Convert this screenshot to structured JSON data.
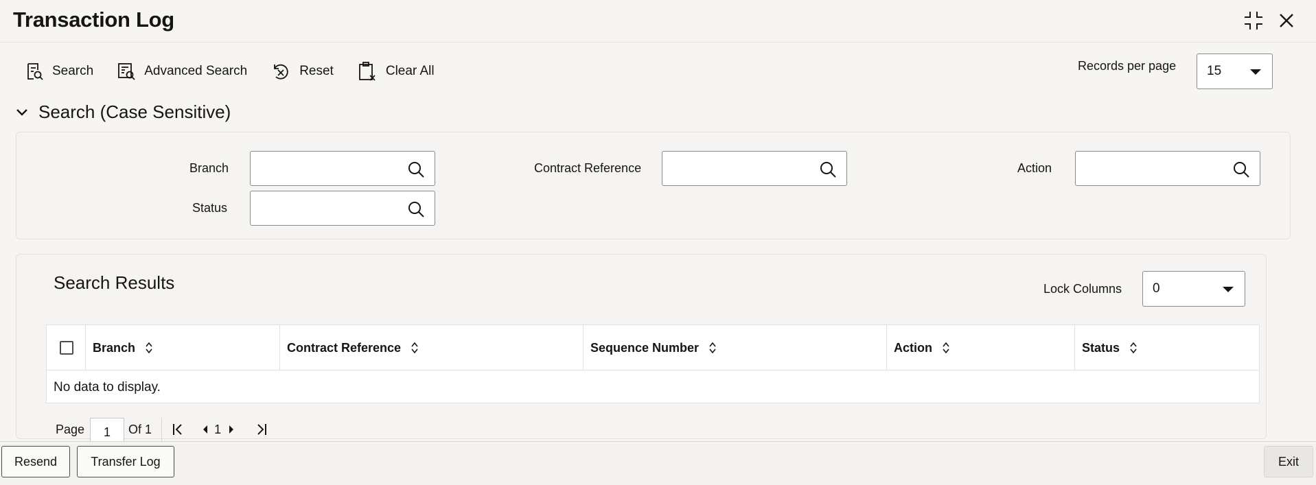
{
  "window": {
    "title": "Transaction Log"
  },
  "toolbar": {
    "search_label": "Search",
    "advanced_search_label": "Advanced Search",
    "reset_label": "Reset",
    "clear_all_label": "Clear All",
    "records_per_page_label": "Records per page",
    "records_per_page_value": "15"
  },
  "search_section": {
    "heading": "Search (Case Sensitive)",
    "fields": {
      "branch_label": "Branch",
      "branch_value": "",
      "contract_reference_label": "Contract Reference",
      "contract_reference_value": "",
      "action_label": "Action",
      "action_value": "",
      "status_label": "Status",
      "status_value": ""
    }
  },
  "results": {
    "title": "Search Results",
    "lock_columns_label": "Lock Columns",
    "lock_columns_value": "0",
    "columns": [
      "Branch",
      "Contract Reference",
      "Sequence Number",
      "Action",
      "Status"
    ],
    "empty_message": "No data to display.",
    "pager": {
      "page_label": "Page",
      "page_value": "1",
      "of_label": "Of 1",
      "current_page": "1"
    }
  },
  "footer": {
    "resend_label": "Resend",
    "transfer_log_label": "Transfer Log",
    "exit_label": "Exit"
  }
}
